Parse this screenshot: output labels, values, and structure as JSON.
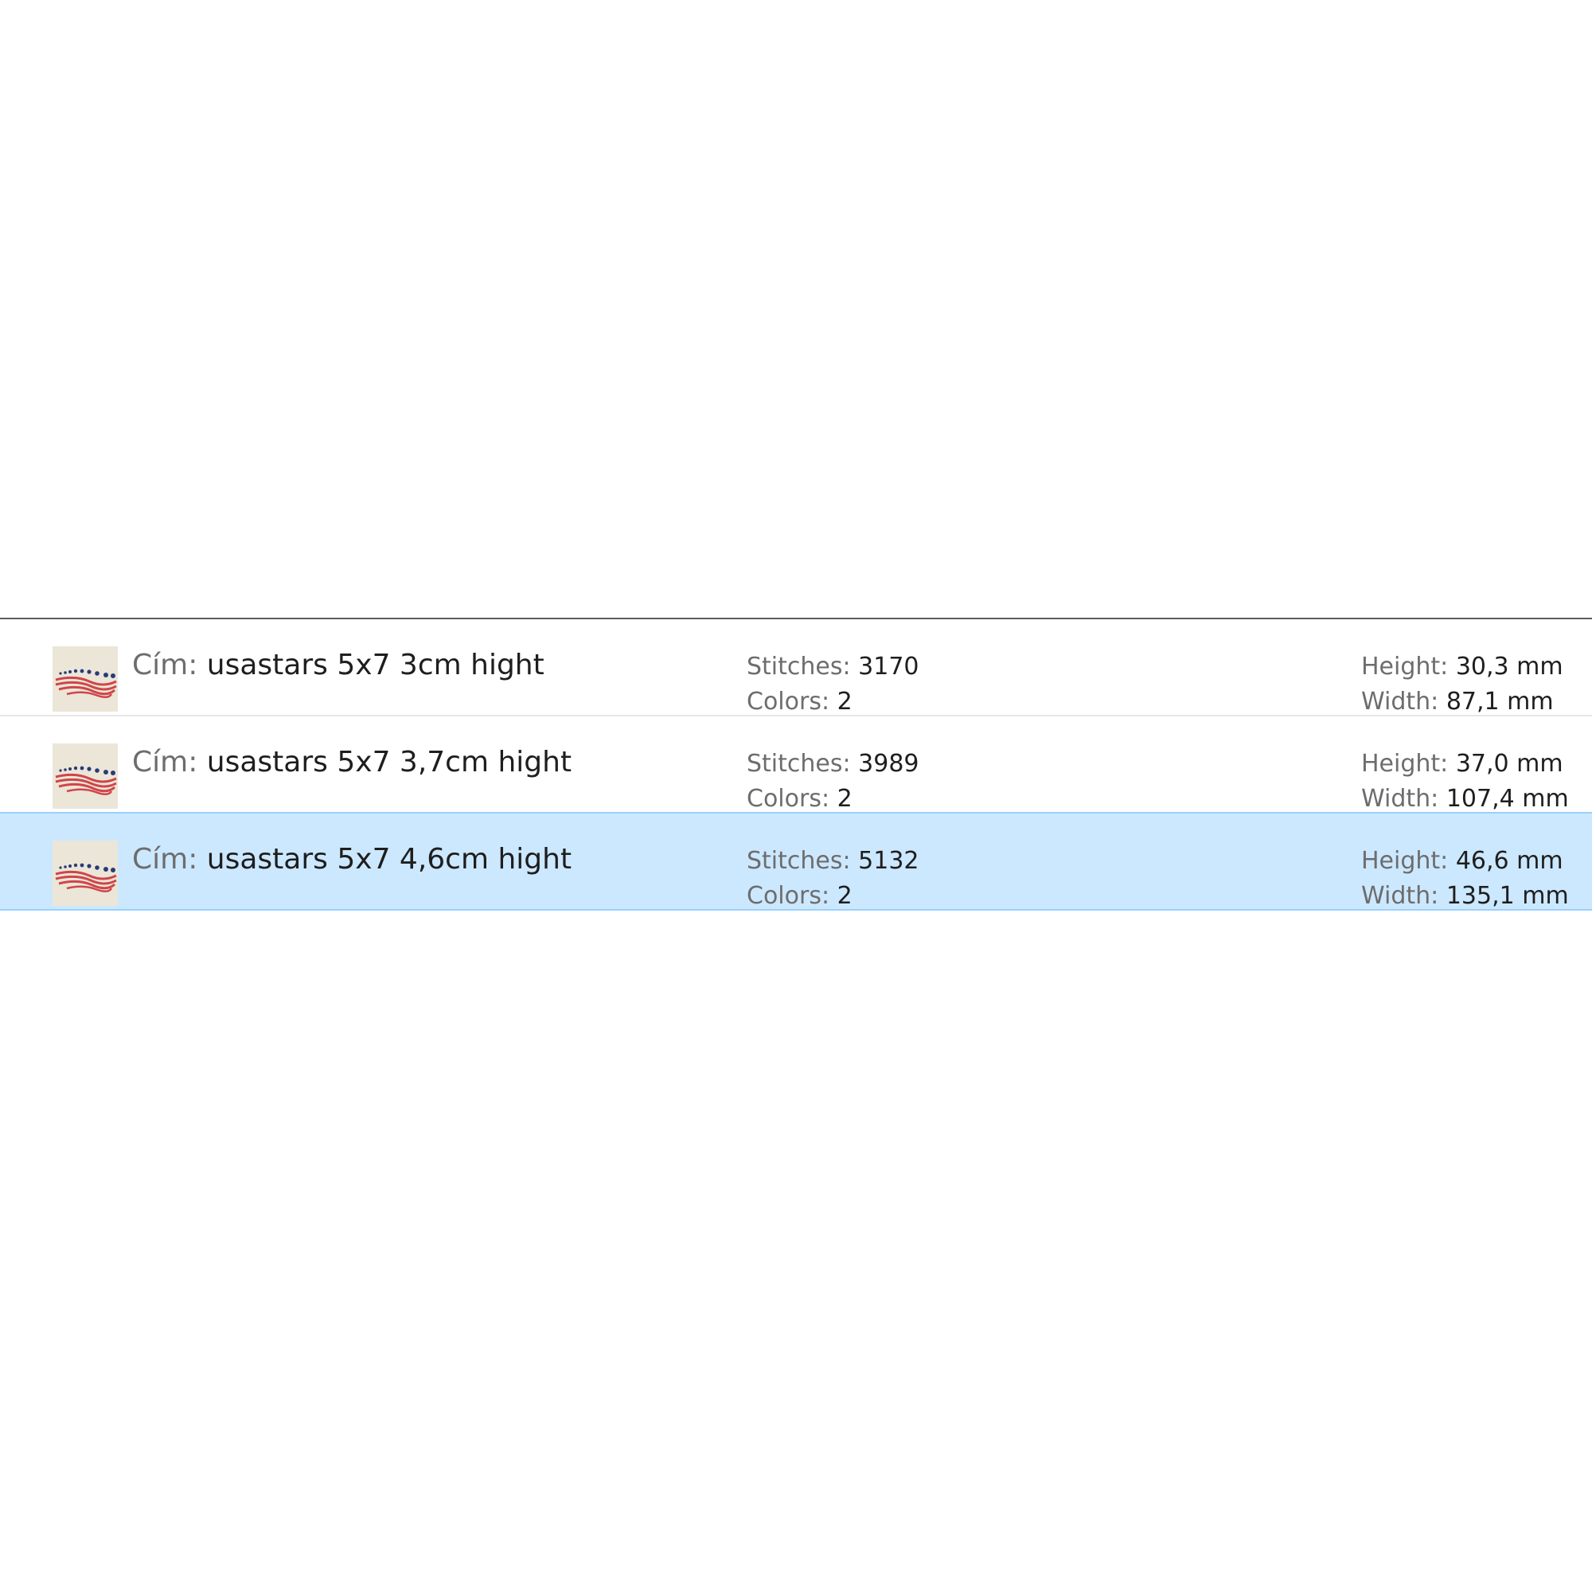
{
  "labels": {
    "title": "Cím:",
    "stitches": "Stitches:",
    "colors": "Colors:",
    "height": "Height:",
    "width": "Width:"
  },
  "thumbnail_icon": "usa-stars-flag-embroidery-icon",
  "colors_ui": {
    "selected_row_bg": "#cce8ff",
    "selected_row_border": "#99d1ff",
    "label_text": "#6d6d6d",
    "value_text": "#1e1e1e"
  },
  "files": [
    {
      "title": "usastars 5x7 3cm hight",
      "stitches": "3170",
      "colors": "2",
      "height": "30,3 mm",
      "width": "87,1 mm",
      "selected": false
    },
    {
      "title": "usastars 5x7 3,7cm hight",
      "stitches": "3989",
      "colors": "2",
      "height": "37,0 mm",
      "width": "107,4 mm",
      "selected": false
    },
    {
      "title": "usastars 5x7 4,6cm hight",
      "stitches": "5132",
      "colors": "2",
      "height": "46,6 mm",
      "width": "135,1 mm",
      "selected": true
    }
  ]
}
